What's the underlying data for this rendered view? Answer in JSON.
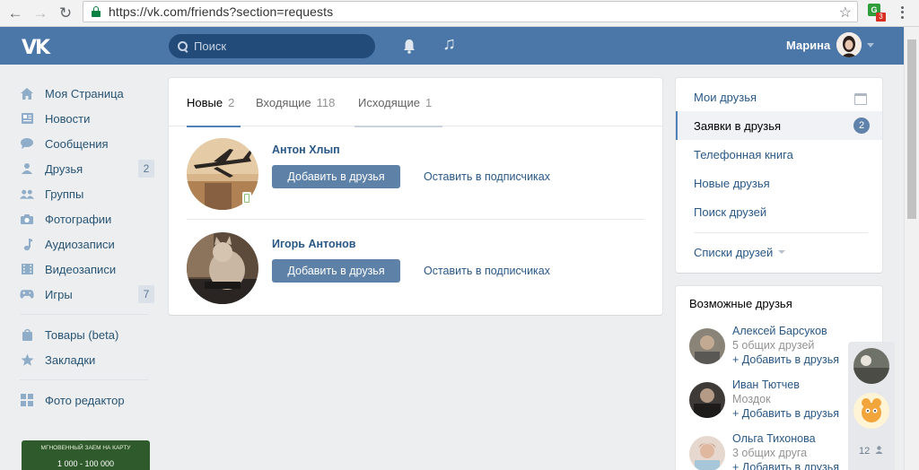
{
  "browser": {
    "url": "https://vk.com/friends?section=requests",
    "extension_badge": "3"
  },
  "header": {
    "logo": "VK",
    "search_placeholder": "Поиск",
    "user_name": "Марина"
  },
  "left_nav": {
    "items": [
      {
        "label": "Моя Страница",
        "icon": "home-icon"
      },
      {
        "label": "Новости",
        "icon": "news-icon"
      },
      {
        "label": "Сообщения",
        "icon": "messages-icon"
      },
      {
        "label": "Друзья",
        "icon": "friends-icon",
        "count": "2"
      },
      {
        "label": "Группы",
        "icon": "groups-icon"
      },
      {
        "label": "Фотографии",
        "icon": "camera-icon"
      },
      {
        "label": "Аудиозаписи",
        "icon": "music-note-icon"
      },
      {
        "label": "Видеозаписи",
        "icon": "film-icon"
      },
      {
        "label": "Игры",
        "icon": "gamepad-icon",
        "count": "7"
      },
      {
        "label": "Товары (beta)",
        "icon": "bag-icon"
      },
      {
        "label": "Закладки",
        "icon": "star-icon"
      },
      {
        "label": "Фото редактор",
        "icon": "grid-icon"
      }
    ],
    "promo_text": "МГНОВЕННЫЙ ЗАЕМ НА КАРТУ",
    "promo_amount": "1 000 - 100 000"
  },
  "requests": {
    "tabs": [
      {
        "label": "Новые",
        "count": "2"
      },
      {
        "label": "Входящие",
        "count": "118"
      },
      {
        "label": "Исходящие",
        "count": "1"
      }
    ],
    "items": [
      {
        "name": "Антон Хлып",
        "add_label": "Добавить в друзья",
        "keep_label": "Оставить в подписчиках"
      },
      {
        "name": "Игорь Антонов",
        "add_label": "Добавить в друзья",
        "keep_label": "Оставить в подписчиках"
      }
    ]
  },
  "right_menu": {
    "items": [
      {
        "label": "Мои друзья"
      },
      {
        "label": "Заявки в друзья",
        "badge": "2"
      },
      {
        "label": "Телефонная книга"
      },
      {
        "label": "Новые друзья"
      },
      {
        "label": "Поиск друзей"
      }
    ],
    "lists_label": "Списки друзей"
  },
  "possible_friends": {
    "title": "Возможные друзья",
    "items": [
      {
        "name": "Алексей Барсуков",
        "sub": "5 общих друзей",
        "add": "+ Добавить в друзья"
      },
      {
        "name": "Иван Тютчев",
        "sub": "Моздок",
        "add": "+ Добавить в друзья"
      },
      {
        "name": "Ольга Тихонова",
        "sub": "3 общих друга",
        "add": "+ Добавить в друзья"
      }
    ]
  },
  "chat_bar": {
    "count": "12"
  },
  "colors": {
    "header_bg": "#4a76a8",
    "link": "#2a5885",
    "button": "#5e81a8",
    "page_bg": "#edeef0"
  }
}
